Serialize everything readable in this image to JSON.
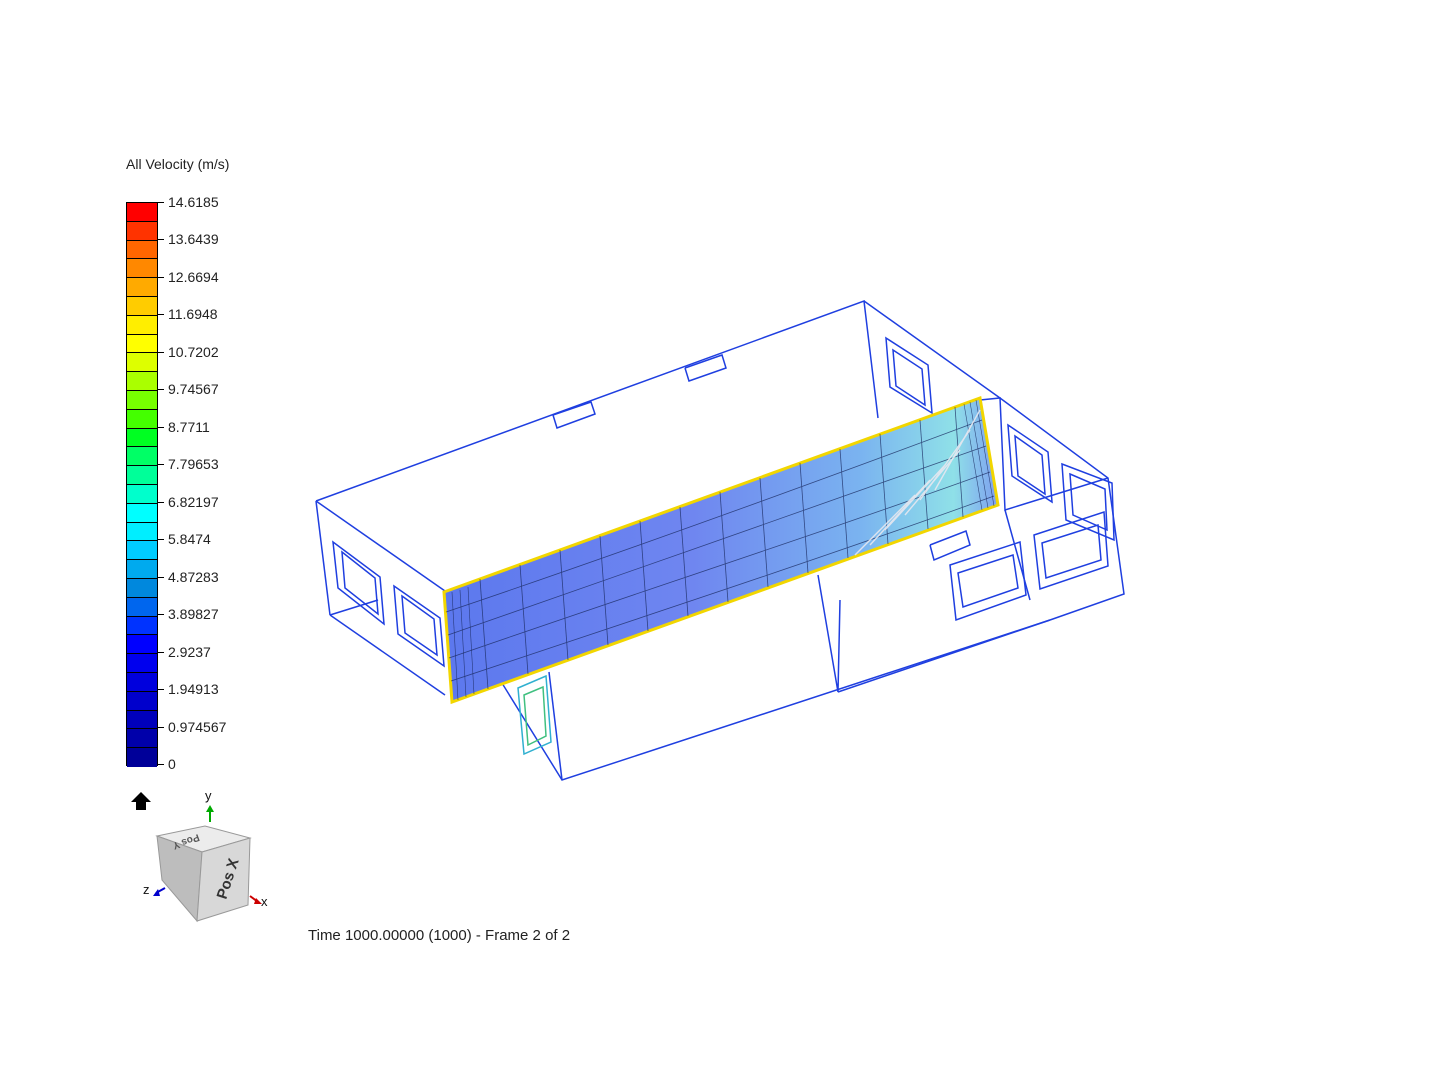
{
  "legend": {
    "title": "All Velocity (m/s)",
    "labels": [
      "14.6185",
      "13.6439",
      "12.6694",
      "11.6948",
      "10.7202",
      "9.74567",
      "8.7711",
      "7.79653",
      "6.82197",
      "5.8474",
      "4.87283",
      "3.89827",
      "2.9237",
      "1.94913",
      "0.974567",
      "0"
    ],
    "colors": [
      "#ff0000",
      "#ff3300",
      "#ff6600",
      "#ff8800",
      "#ffaa00",
      "#ffcc00",
      "#ffee00",
      "#ffff00",
      "#ddff00",
      "#aaff00",
      "#77ff00",
      "#44ff00",
      "#00ff22",
      "#00ff66",
      "#00ff99",
      "#00ffcc",
      "#00ffff",
      "#00eeff",
      "#00ccff",
      "#00aaee",
      "#0088dd",
      "#0066ee",
      "#0033ff",
      "#0000ff",
      "#0000ee",
      "#0000dd",
      "#0000cc",
      "#0000bb",
      "#0000aa",
      "#000099"
    ],
    "accent_outline": "#000000"
  },
  "view_cube": {
    "face_label": "Pos X",
    "top_label": "Pos Y",
    "axes": {
      "x": "x",
      "y": "y",
      "z": "z"
    },
    "x_color": "#cc0000",
    "y_color": "#00aa00",
    "z_color": "#0000cc"
  },
  "home_icon": "home-icon",
  "status": {
    "time_text": "Time 1000.00000 (1000) - Frame 2 of 2"
  },
  "model": {
    "wire_color": "#1f3fe0",
    "plane_color": "#6e86f0",
    "plane_border": "#f2d600"
  }
}
